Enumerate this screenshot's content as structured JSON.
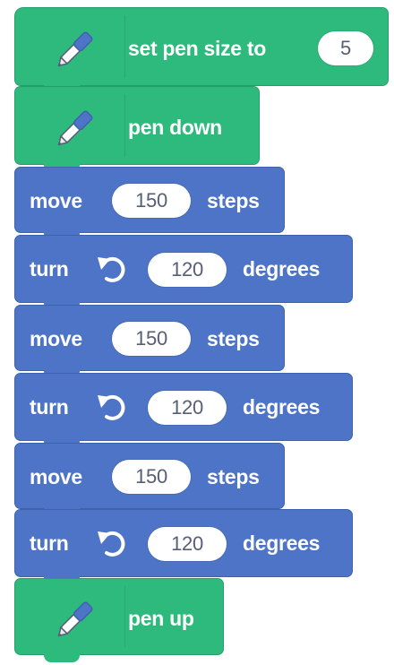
{
  "blocks": {
    "set_pen_size": {
      "label": "set pen size to",
      "value": "5"
    },
    "pen_down": {
      "label": "pen down"
    },
    "move_1": {
      "label_before": "move",
      "value": "150",
      "label_after": "steps"
    },
    "turn_1": {
      "label_before": "turn",
      "value": "120",
      "label_after": "degrees"
    },
    "move_2": {
      "label_before": "move",
      "value": "150",
      "label_after": "steps"
    },
    "turn_2": {
      "label_before": "turn",
      "value": "120",
      "label_after": "degrees"
    },
    "move_3": {
      "label_before": "move",
      "value": "150",
      "label_after": "steps"
    },
    "turn_3": {
      "label_before": "turn",
      "value": "120",
      "label_after": "degrees"
    },
    "pen_up": {
      "label": "pen up"
    }
  },
  "icons": {
    "pen_extension": "pen-icon",
    "turn_direction": "rotate-left-icon"
  },
  "colors": {
    "pen_category": "#2fba7d",
    "motion_category": "#4d74c6",
    "input_text": "#575e75"
  }
}
